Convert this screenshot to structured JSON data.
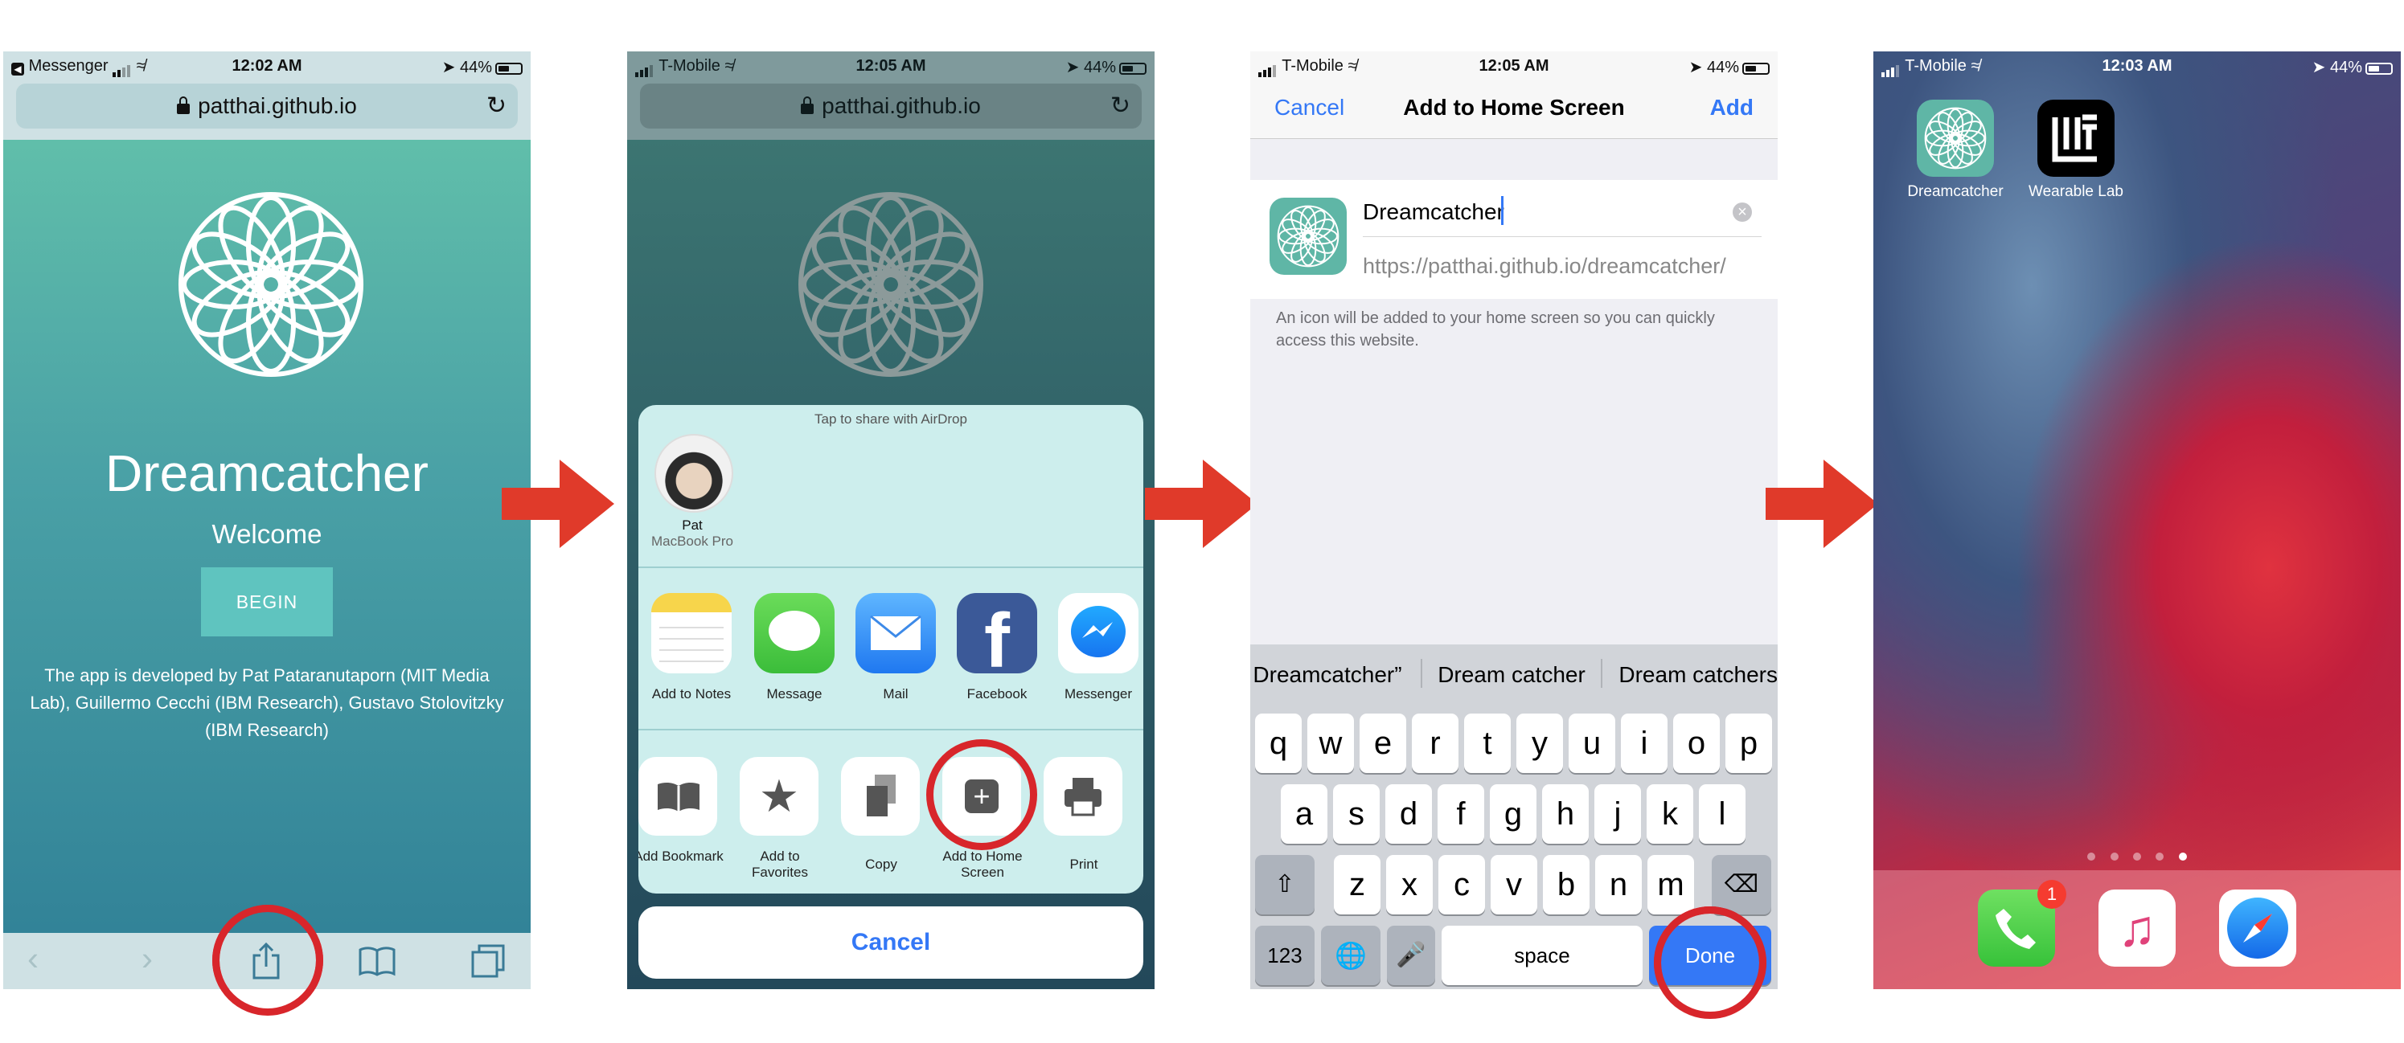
{
  "screen1": {
    "status": {
      "carrier": "Messenger",
      "time": "12:02 AM",
      "battery": "44%"
    },
    "url": "patthai.github.io",
    "title": "Dreamcatcher",
    "subtitle": "Welcome",
    "begin_label": "BEGIN",
    "credits": "The app is developed by Pat Pataranutaporn (MIT Media Lab), Guillermo Cecchi (IBM Research), Gustavo Stolovitzky (IBM Research)"
  },
  "screen2": {
    "status": {
      "carrier": "T-Mobile",
      "time": "12:05 AM",
      "battery": "44%"
    },
    "url": "patthai.github.io",
    "airdrop_hint": "Tap to share with AirDrop",
    "contact": {
      "name": "Pat",
      "device": "MacBook Pro"
    },
    "apps": [
      {
        "label": "Add to Notes",
        "icon": "notes-icon"
      },
      {
        "label": "Message",
        "icon": "message-icon"
      },
      {
        "label": "Mail",
        "icon": "mail-icon"
      },
      {
        "label": "Facebook",
        "icon": "facebook-icon"
      },
      {
        "label": "Messenger",
        "icon": "messenger-icon"
      }
    ],
    "actions": [
      {
        "label": "Add Bookmark",
        "icon": "book-icon"
      },
      {
        "label": "Add to Favorites",
        "icon": "star-icon"
      },
      {
        "label": "Copy",
        "icon": "copy-icon"
      },
      {
        "label": "Add to Home Screen",
        "icon": "plus-square-icon"
      },
      {
        "label": "Print",
        "icon": "printer-icon"
      }
    ],
    "cancel_label": "Cancel"
  },
  "screen3": {
    "status": {
      "carrier": "T-Mobile",
      "time": "12:05 AM",
      "battery": "44%"
    },
    "nav": {
      "cancel": "Cancel",
      "title": "Add to Home Screen",
      "add": "Add"
    },
    "name_value": "Dreamcatcher",
    "url_value": "https://patthai.github.io/dreamcatcher/",
    "hint": "An icon will be added to your home screen so you can quickly access this website.",
    "suggestions": [
      "Dreamcatcher”",
      "Dream catcher",
      "Dream catchers"
    ],
    "keyboard": {
      "row1": [
        "q",
        "w",
        "e",
        "r",
        "t",
        "y",
        "u",
        "i",
        "o",
        "p"
      ],
      "row2": [
        "a",
        "s",
        "d",
        "f",
        "g",
        "h",
        "j",
        "k",
        "l"
      ],
      "row3": [
        "z",
        "x",
        "c",
        "v",
        "b",
        "n",
        "m"
      ],
      "num_label": "123",
      "space_label": "space",
      "done_label": "Done"
    }
  },
  "screen4": {
    "status": {
      "carrier": "T-Mobile",
      "time": "12:03 AM",
      "battery": "44%"
    },
    "apps": [
      {
        "label": "Dreamcatcher",
        "icon": "dreamcatcher-app-icon"
      },
      {
        "label": "Wearable Lab",
        "icon": "wearable-lab-icon"
      }
    ],
    "phone_badge": "1",
    "page_dots": 5,
    "active_dot": 5,
    "dock": [
      {
        "name": "Phone",
        "icon": "phone-icon"
      },
      {
        "name": "Music",
        "icon": "music-icon"
      },
      {
        "name": "Safari",
        "icon": "safari-icon"
      }
    ]
  },
  "colors": {
    "arrow": "#e03a2a",
    "highlight_ring": "#d8262b",
    "ios_blue": "#3478f6",
    "teal": "#5fc4b5"
  }
}
